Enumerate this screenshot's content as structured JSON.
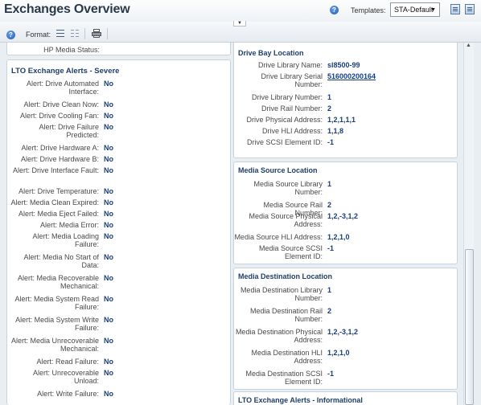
{
  "header": {
    "title": "Exchanges Overview",
    "help_glyph": "?",
    "templates_label": "Templates:",
    "template_selected": "STA-Default"
  },
  "toolbar": {
    "help_glyph": "?",
    "format_label": "Format:"
  },
  "left": {
    "top_partial_label": "HP Media Status:",
    "severe_title": "LTO Exchange Alerts - Severe",
    "severe_rows": [
      {
        "label": "Alert: Drive Automated Interface:",
        "value": "No"
      },
      {
        "label": "Alert: Drive Clean Now:",
        "value": "No"
      },
      {
        "label": "Alert: Drive Cooling Fan:",
        "value": "No"
      },
      {
        "label": "Alert: Drive Failure Predicted:",
        "value": "No"
      },
      {
        "label": "Alert: Drive Hardware A:",
        "value": "No"
      },
      {
        "label": "Alert: Drive Hardware B:",
        "value": "No"
      },
      {
        "label": "Alert: Drive Interface Fault:",
        "value": "No"
      },
      {
        "label": "Alert: Drive Temperature:",
        "value": "No"
      },
      {
        "label": "Alert: Media Clean Expired:",
        "value": "No"
      },
      {
        "label": "Alert: Media Eject Failed:",
        "value": "No"
      },
      {
        "label": "Alert: Media Error:",
        "value": "No"
      },
      {
        "label": "Alert: Media Loading Failure:",
        "value": "No"
      },
      {
        "label": "Alert: Media No Start of Data:",
        "value": "No"
      },
      {
        "label": "Alert: Media Recoverable Mechanical:",
        "value": "No"
      },
      {
        "label": "Alert: Media System Read Failure:",
        "value": "No"
      },
      {
        "label": "Alert: Media System Write Failure:",
        "value": "No"
      },
      {
        "label": "Alert: Media Unrecoverable Mechanical:",
        "value": "No"
      },
      {
        "label": "Alert: Read Failure:",
        "value": "No"
      },
      {
        "label": "Alert: Unrecoverable Unload:",
        "value": "No"
      },
      {
        "label": "Alert: Write Failure:",
        "value": "No"
      }
    ]
  },
  "right": {
    "drive_bay": {
      "title": "Drive Bay Location",
      "rows": [
        {
          "label": "Drive Library Name:",
          "value": "sl8500-99"
        },
        {
          "label": "Drive Library Serial Number:",
          "value": "516000200164"
        },
        {
          "label": "Drive Library Number:",
          "value": "1"
        },
        {
          "label": "Drive Rail Number:",
          "value": "2"
        },
        {
          "label": "Drive Physical Address:",
          "value": "1,2,1,1,1"
        },
        {
          "label": "Drive HLI Address:",
          "value": "1,1,8"
        },
        {
          "label": "Drive SCSI Element ID:",
          "value": "-1"
        }
      ]
    },
    "media_source": {
      "title": "Media Source Location",
      "rows": [
        {
          "label": "Media Source Library Number:",
          "value": "1"
        },
        {
          "label": "Media Source Rail Number:",
          "value": "2"
        },
        {
          "label": "Media Source Physical Address:",
          "value": "1,2,-3,1,2"
        },
        {
          "label": "Media Source HLI Address:",
          "value": "1,2,1,0"
        },
        {
          "label": "Media Source SCSI Element ID:",
          "value": "-1"
        }
      ]
    },
    "media_dest": {
      "title": "Media Destination Location",
      "rows": [
        {
          "label": "Media Destination Library Number:",
          "value": "1"
        },
        {
          "label": "Media Destination Rail Number:",
          "value": "2"
        },
        {
          "label": "Media Destination Physical Address:",
          "value": "1,2,-3,1,2"
        },
        {
          "label": "Media Destination HLI Address:",
          "value": "1,2,1,0"
        },
        {
          "label": "Media Destination SCSI Element ID:",
          "value": "-1"
        }
      ]
    },
    "info_title": "LTO Exchange Alerts - Informational"
  },
  "icons": {
    "help": "help-icon",
    "templates_manage": "manage-templates-icon",
    "templates_save": "save-template-icon",
    "format_list": "list-view-icon",
    "format_grid": "grid-view-icon",
    "print": "print-icon",
    "collapse": "collapse-toolbar-icon"
  }
}
